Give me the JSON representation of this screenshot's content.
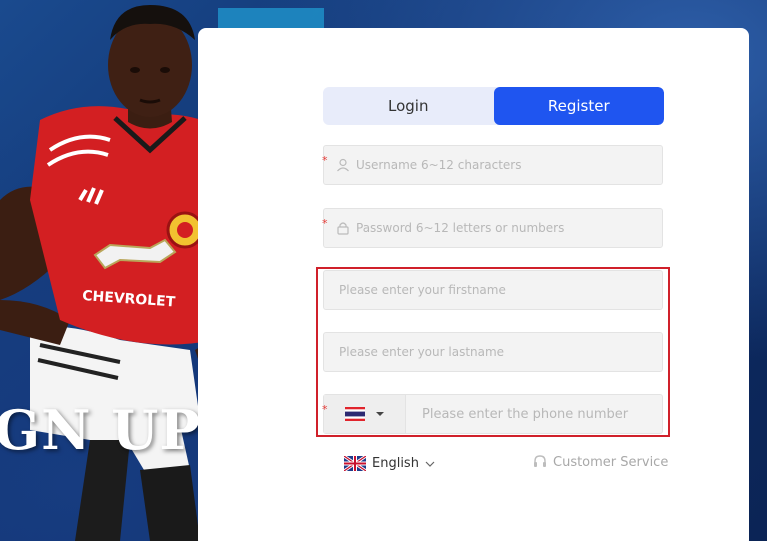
{
  "hero": {
    "banner_text": "GN UP"
  },
  "tabs": [
    {
      "label": "Login",
      "active": false
    },
    {
      "label": "Register",
      "active": true
    }
  ],
  "form": {
    "username_placeholder": "Username 6~12 characters",
    "password_placeholder": "Password 6~12 letters or numbers",
    "firstname_placeholder": "Please enter your firstname",
    "lastname_placeholder": "Please enter your lastname",
    "phone_placeholder": "Please enter the phone number",
    "required_marker": "*",
    "country_flag": "thailand-flag-icon"
  },
  "footer": {
    "language_label": "English",
    "language_flag": "uk-flag-icon",
    "customer_service_label": "Customer Service"
  },
  "colors": {
    "accent": "#1f55f0",
    "tab_inactive_bg": "#e8ecfa",
    "highlight_border": "#d0202a",
    "required": "#e53935"
  }
}
